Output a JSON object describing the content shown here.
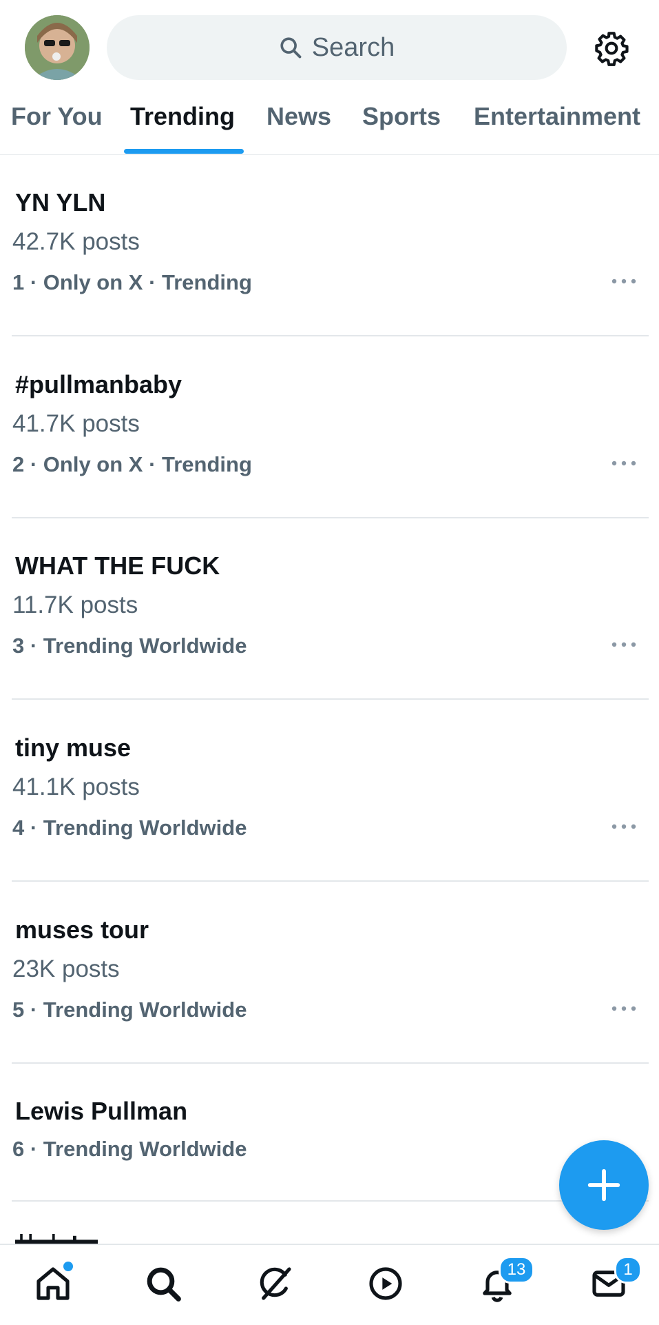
{
  "header": {
    "search_placeholder": "Search"
  },
  "tabs": [
    {
      "label": "For You"
    },
    {
      "label": "Trending"
    },
    {
      "label": "News"
    },
    {
      "label": "Sports"
    },
    {
      "label": "Entertainment"
    }
  ],
  "trends": [
    {
      "title": "YN YLN",
      "posts": "42.7K posts",
      "meta": "1 · Only on X · Trending"
    },
    {
      "title": "#pullmanbaby",
      "posts": "41.7K posts",
      "meta": "2 · Only on X · Trending"
    },
    {
      "title": "WHAT THE FUCK",
      "posts": "11.7K posts",
      "meta": "3 · Trending Worldwide"
    },
    {
      "title": "tiny muse",
      "posts": "41.1K posts",
      "meta": "4 · Trending Worldwide"
    },
    {
      "title": "muses tour",
      "posts": "23K posts",
      "meta": "5 · Trending Worldwide"
    },
    {
      "title": "Lewis Pullman",
      "meta": "6 · Trending Worldwide"
    }
  ],
  "bottom_nav": {
    "notifications_badge": "13",
    "messages_badge": "1"
  },
  "colors": {
    "accent": "#1d9bf0",
    "text_primary": "#0f1419",
    "text_secondary": "#536471"
  }
}
